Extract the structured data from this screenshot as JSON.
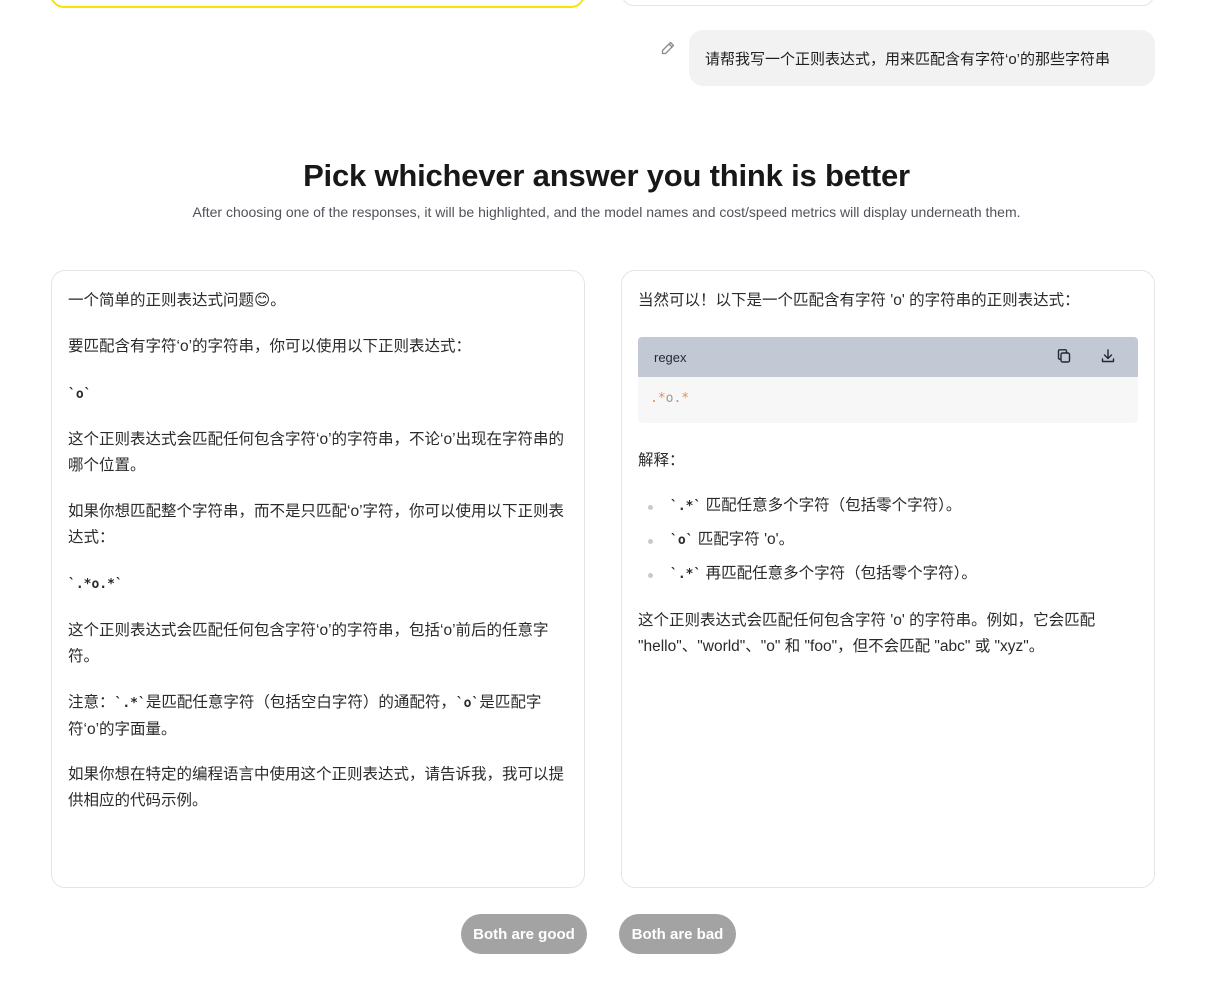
{
  "user_message": {
    "text": "请帮我写一个正则表达式，用来匹配含有字符‘o’的那些字符串",
    "edit_icon": "pencil-icon"
  },
  "heading": "Pick whichever answer you think is better",
  "subheading": "After choosing one of the responses, it will be highlighted, and the model names and cost/speed metrics will display underneath them.",
  "left_response": {
    "intro_text": "一个简单的正则表达式问题",
    "intro_emoji": "😊",
    "intro_end": "。",
    "p1": "要匹配含有字符‘o’的字符串，你可以使用以下正则表达式：",
    "code1": "`o`",
    "p2": "这个正则表达式会匹配任何包含字符‘o’的字符串，不论‘o’出现在字符串的哪个位置。",
    "p3": "如果你想匹配整个字符串，而不是只匹配‘o’字符，你可以使用以下正则表达式：",
    "code2": "`.*o.*`",
    "p4": "这个正则表达式会匹配任何包含字符‘o’的字符串，包括‘o’前后的任意字符。",
    "note_prefix": "注意：",
    "note_code1": "`.*`",
    "note_mid": "是匹配任意字符（包括空白字符）的通配符，",
    "note_code2": "`o`",
    "note_end": "是匹配字符‘o’的字面量。",
    "p5": "如果你想在特定的编程语言中使用这个正则表达式，请告诉我，我可以提供相应的代码示例。"
  },
  "right_response": {
    "intro": "当然可以！以下是一个匹配含有字符 'o' 的字符串的正则表达式：",
    "code_lang": "regex",
    "copy_icon": "copy-icon",
    "download_icon": "download-icon",
    "code_prefix": ".*",
    "code_mid": "o",
    "code_suffix": ".*",
    "explain_label": "解释：",
    "bullets": [
      {
        "code": "`.*`",
        "text": " 匹配任意多个字符（包括零个字符）。"
      },
      {
        "code": "`o`",
        "text": " 匹配字符 'o'。"
      },
      {
        "code": "`.*`",
        "text": " 再匹配任意多个字符（包括零个字符）。"
      }
    ],
    "outro": "这个正则表达式会匹配任何包含字符 'o' 的字符串。例如，它会匹配 \"hello\"、\"world\"、\"o\" 和 \"foo\"，但不会匹配 \"abc\" 或 \"xyz\"。"
  },
  "buttons": {
    "both_good": "Both are good",
    "both_bad": "Both are bad"
  }
}
